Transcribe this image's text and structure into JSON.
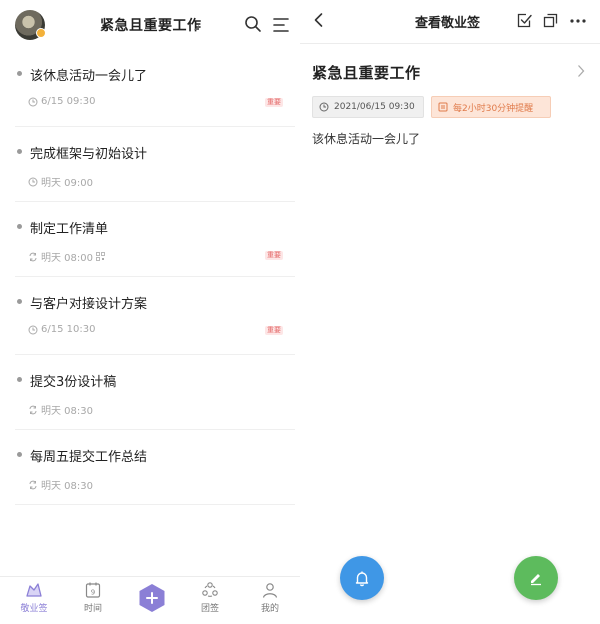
{
  "left": {
    "header": {
      "title": "紧急且重要工作",
      "avatar_icon": "avatar-photo",
      "search_icon": "search-icon",
      "menu_icon": "menu-icon"
    },
    "items": [
      {
        "title": "该休息活动一会儿了",
        "time": "6/15 09:30",
        "time_icon": "clock-icon",
        "tag": "重要"
      },
      {
        "title": "完成框架与初始设计",
        "time": "明天 09:00",
        "time_icon": "clock-icon",
        "tag": ""
      },
      {
        "title": "制定工作清单",
        "time": "明天 08:00",
        "time_icon": "repeat-icon",
        "tag": "重要"
      },
      {
        "title": "与客户对接设计方案",
        "time": "6/15 10:30",
        "time_icon": "clock-icon",
        "tag": "重要"
      },
      {
        "title": "提交3份设计稿",
        "time": "明天 08:30",
        "time_icon": "repeat-icon",
        "tag": ""
      },
      {
        "title": "每周五提交工作总结",
        "time": "明天 08:30",
        "time_icon": "repeat-icon",
        "tag": ""
      }
    ],
    "tabbar": {
      "tabs": [
        {
          "label": "敬业签",
          "icon": "note-icon",
          "active": true
        },
        {
          "label": "时间",
          "icon": "calendar-icon",
          "active": false
        },
        {
          "label": "团签",
          "icon": "team-icon",
          "active": false
        },
        {
          "label": "我的",
          "icon": "user-icon",
          "active": false
        }
      ],
      "add_icon": "plus-hexagon-icon",
      "calendar_day": "9"
    }
  },
  "right": {
    "header": {
      "title": "查看敬业签",
      "back_icon": "back-icon",
      "check_icon": "check-square-icon",
      "copy_icon": "copy-icon",
      "more_icon": "more-icon"
    },
    "note": {
      "title": "紧急且重要工作",
      "date": "2021/06/15 09:30",
      "remind": "每2小时30分钟提醒",
      "content": "该休息活动一会儿了"
    },
    "fabs": {
      "bell_icon": "bell-icon",
      "edit_icon": "edit-icon"
    }
  },
  "colors": {
    "accent_purple": "#8b7fd6",
    "tag_red": "#e46a6a",
    "remind_orange": "#e07a4a",
    "fab_blue": "#3f97e6",
    "fab_green": "#5dbb5d"
  }
}
